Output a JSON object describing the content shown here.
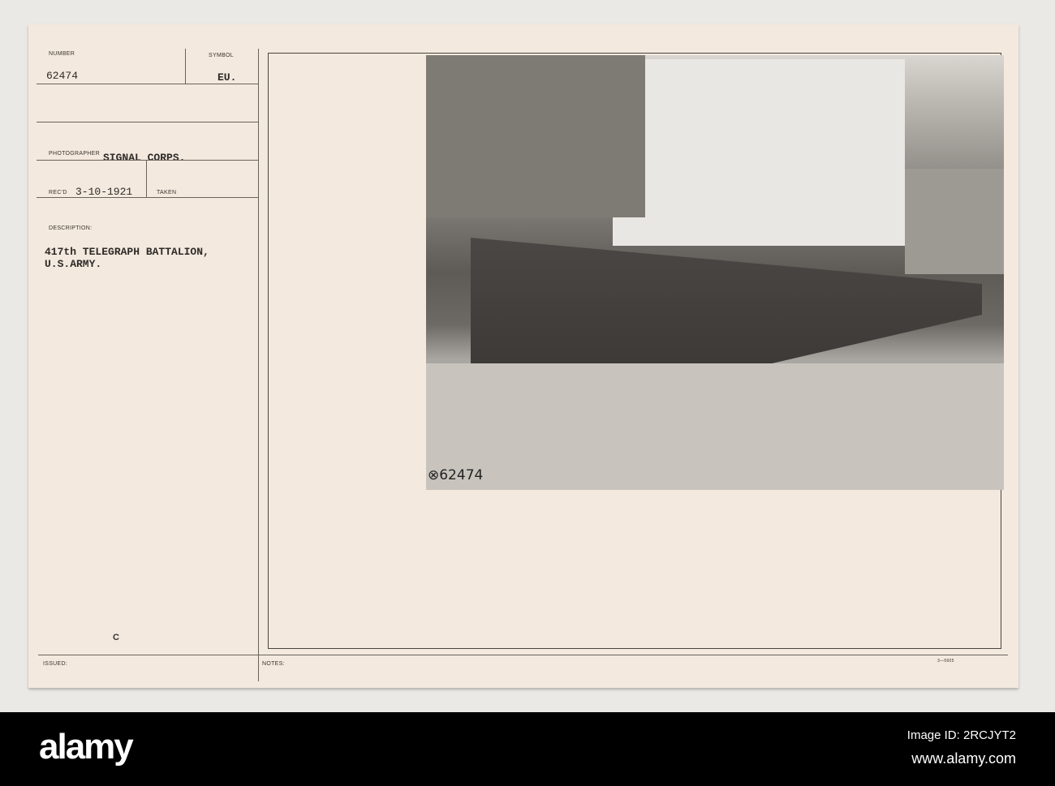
{
  "card": {
    "number_label": "NUMBER",
    "number": "62474",
    "symbol_label": "SYMBOL",
    "symbol": "EU.",
    "photographer_label": "PHOTOGRAPHER",
    "photographer": "SIGNAL CORPS.",
    "recd_label": "REC'D",
    "recd": "3-10-1921",
    "taken_label": "TAKEN",
    "description_label": "DESCRIPTION:",
    "description_line1": "417th TELEGRAPH BATTALION,",
    "description_line2": "U.S.ARMY.",
    "class_mark": "C",
    "issued_label": "ISSUED:",
    "notes_label": "NOTES:",
    "form_number": "3—5605",
    "photo_number": "⊗62474"
  },
  "footer": {
    "brand": "alamy",
    "image_id": "Image ID: 2RCJYT2",
    "url": "www.alamy.com"
  }
}
